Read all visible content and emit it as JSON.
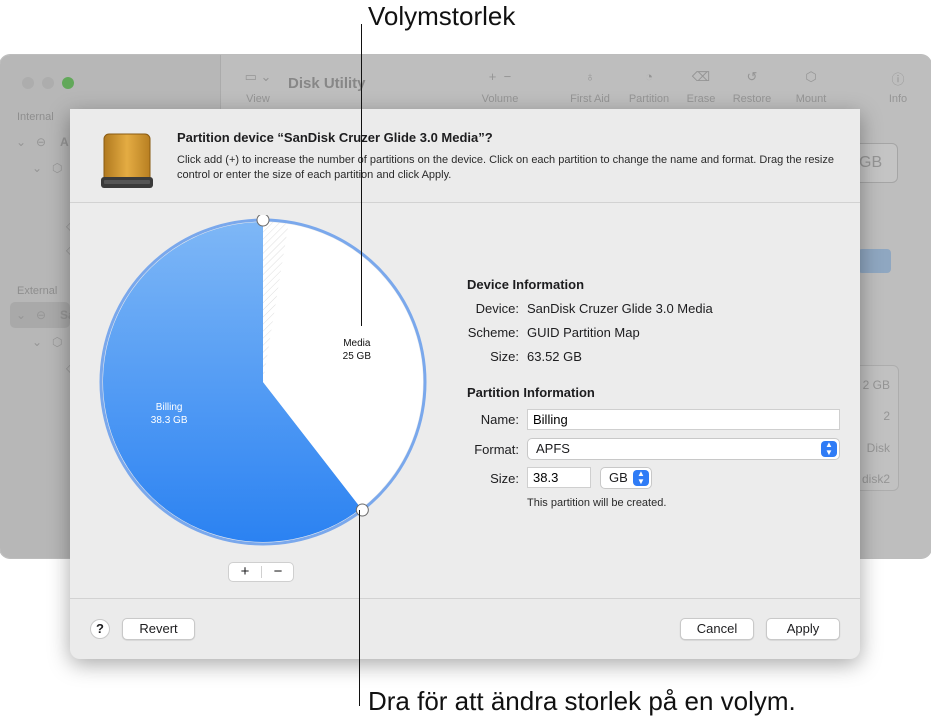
{
  "callouts": {
    "top": "Volymstorlek",
    "bottom": "Dra för att ändra storlek på en volym."
  },
  "background_window": {
    "title": "Disk Utility",
    "view_label": "View",
    "toolbar": [
      "Volume",
      "First Aid",
      "Partition",
      "Erase",
      "Restore",
      "Mount",
      "Info"
    ],
    "sidebar": {
      "internal_label": "Internal",
      "internal_item": "A",
      "external_label": "External",
      "external_item": "Sa"
    },
    "ghost_values": [
      "GB",
      "2 GB",
      "2",
      "Disk",
      "disk2"
    ]
  },
  "dialog": {
    "title": "Partition device “SanDisk Cruzer Glide 3.0 Media”?",
    "description": "Click add (+) to increase the number of partitions on the device. Click on each partition to change the name and format. Drag the resize control or enter the size of each partition and click Apply.",
    "add_label": "+",
    "remove_label": "−",
    "device_info": {
      "heading": "Device Information",
      "device_label": "Device:",
      "device_value": "SanDisk Cruzer Glide 3.0 Media",
      "scheme_label": "Scheme:",
      "scheme_value": "GUID Partition Map",
      "size_label": "Size:",
      "size_value": "63.52 GB"
    },
    "partition_info": {
      "heading": "Partition Information",
      "name_label": "Name:",
      "name_value": "Billing",
      "format_label": "Format:",
      "format_value": "APFS",
      "size_label": "Size:",
      "size_value": "38.3",
      "unit_value": "GB",
      "note": "This partition will be created."
    },
    "help_label": "?",
    "revert_label": "Revert",
    "cancel_label": "Cancel",
    "apply_label": "Apply"
  },
  "chart_data": {
    "type": "pie",
    "slices": [
      {
        "name": "Billing",
        "label": "38.3 GB",
        "value": 38.3,
        "color": "#3d8ef2"
      },
      {
        "name": "Media",
        "label": "25 GB",
        "value": 25,
        "color": "#ffffff"
      }
    ],
    "title": ""
  },
  "colors": {
    "accent": "#2f7cf6",
    "pie_border": "#7aa8ec"
  }
}
